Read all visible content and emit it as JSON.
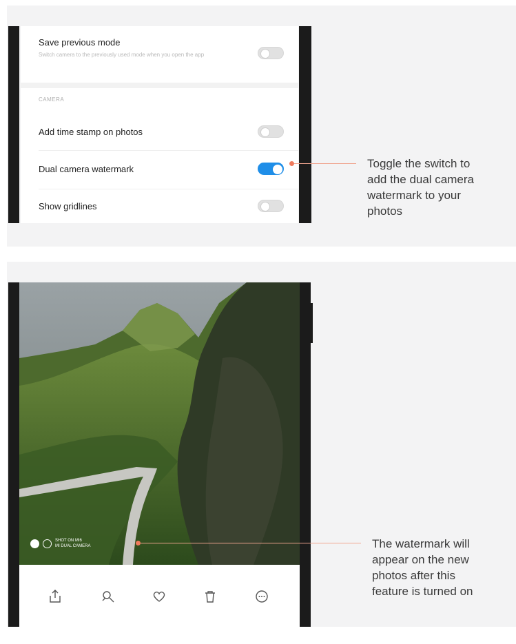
{
  "settings": {
    "save_previous_mode": {
      "title": "Save previous mode",
      "subtitle": "Switch camera to the previously used mode when you open the app",
      "toggle_on": false
    },
    "section_label": "CAMERA",
    "add_time_stamp": {
      "title": "Add time stamp on photos",
      "toggle_on": false
    },
    "dual_camera_watermark": {
      "title": "Dual camera watermark",
      "toggle_on": true
    },
    "show_gridlines": {
      "title": "Show gridlines",
      "toggle_on": false
    }
  },
  "callouts": {
    "toggle": [
      "Toggle the switch to",
      "add the dual camera",
      "watermark to your",
      "photos"
    ],
    "watermark": [
      "The watermark will",
      "appear on the new",
      "photos after this",
      "feature is turned on"
    ]
  },
  "photo": {
    "watermark_line1": "SHOT ON MI6",
    "watermark_line2": "MI DUAL CAMERA",
    "actions": [
      "share-icon",
      "edit-icon",
      "favorite-icon",
      "delete-icon",
      "more-icon"
    ]
  },
  "colors": {
    "accent": "#1f8ee8",
    "callout": "#f07a5d"
  }
}
